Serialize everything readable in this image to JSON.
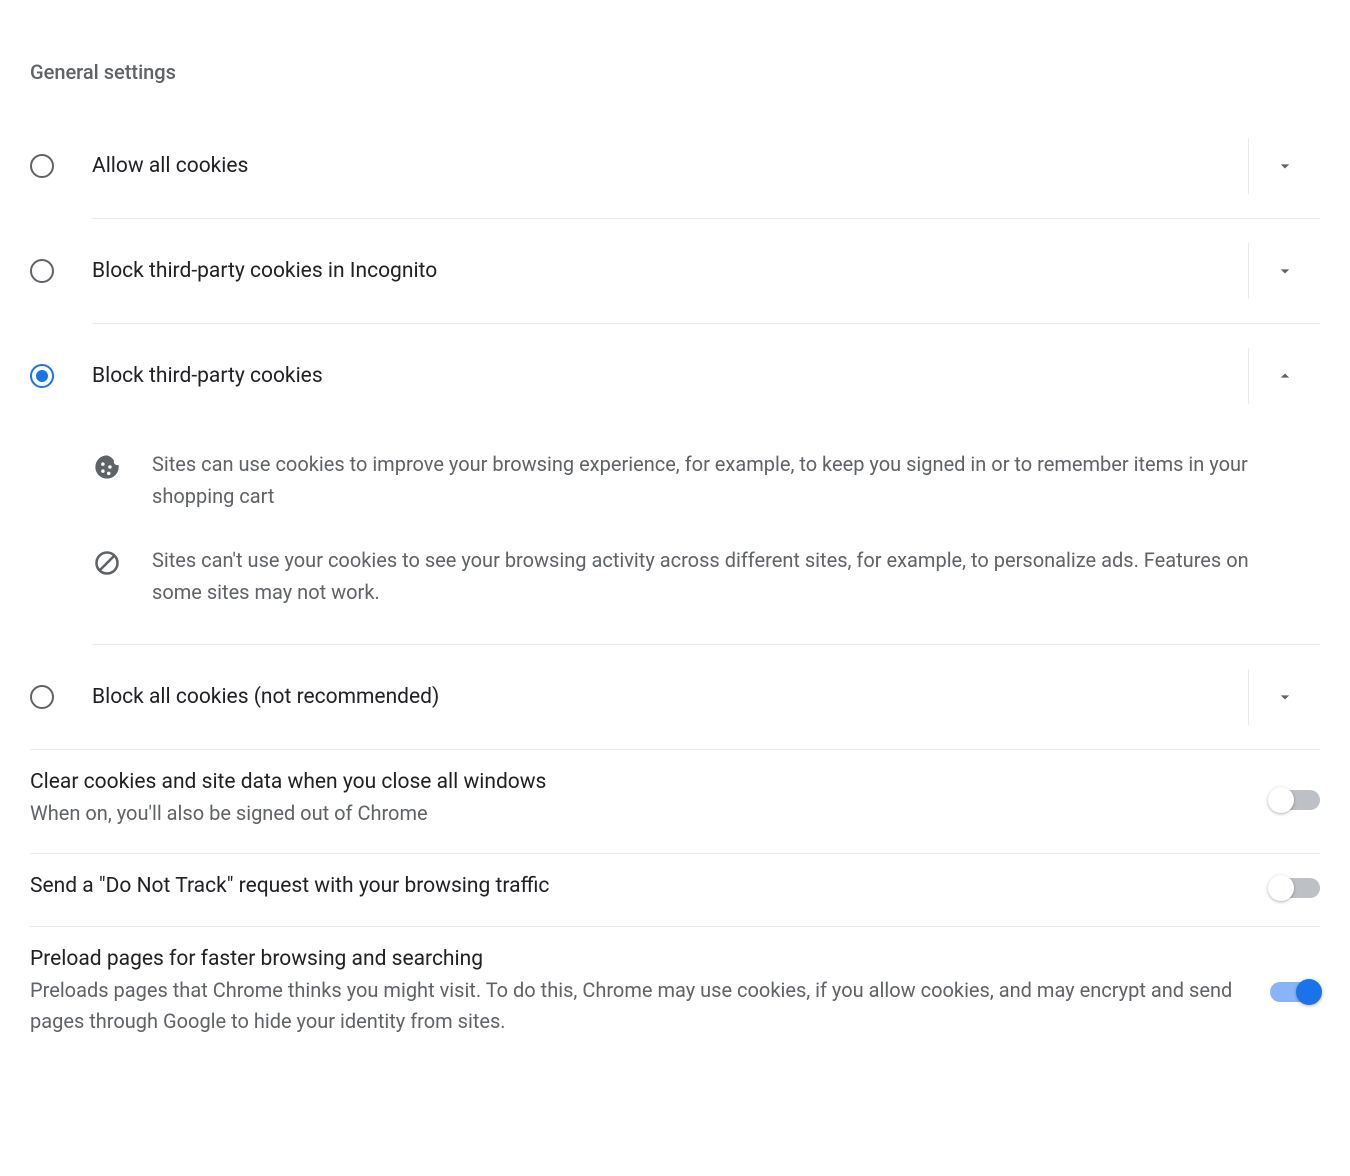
{
  "section_title": "General settings",
  "radio_options": [
    {
      "label": "Allow all cookies",
      "selected": false,
      "expanded": false
    },
    {
      "label": "Block third-party cookies in Incognito",
      "selected": false,
      "expanded": false
    },
    {
      "label": "Block third-party cookies",
      "selected": true,
      "expanded": true
    },
    {
      "label": "Block all cookies (not recommended)",
      "selected": false,
      "expanded": false
    }
  ],
  "expanded_info": [
    {
      "icon": "cookie-icon",
      "text": "Sites can use cookies to improve your browsing experience, for example, to keep you signed in or to remember items in your shopping cart"
    },
    {
      "icon": "block-icon",
      "text": "Sites can't use your cookies to see your browsing activity across different sites, for example, to personalize ads. Features on some sites may not work."
    }
  ],
  "toggles": [
    {
      "title": "Clear cookies and site data when you close all windows",
      "subtitle": "When on, you'll also be signed out of Chrome",
      "on": false
    },
    {
      "title": "Send a \"Do Not Track\" request with your browsing traffic",
      "subtitle": "",
      "on": false
    },
    {
      "title": "Preload pages for faster browsing and searching",
      "subtitle": "Preloads pages that Chrome thinks you might visit. To do this, Chrome may use cookies, if you allow cookies, and may encrypt and send pages through Google to hide your identity from sites.",
      "on": true
    }
  ]
}
